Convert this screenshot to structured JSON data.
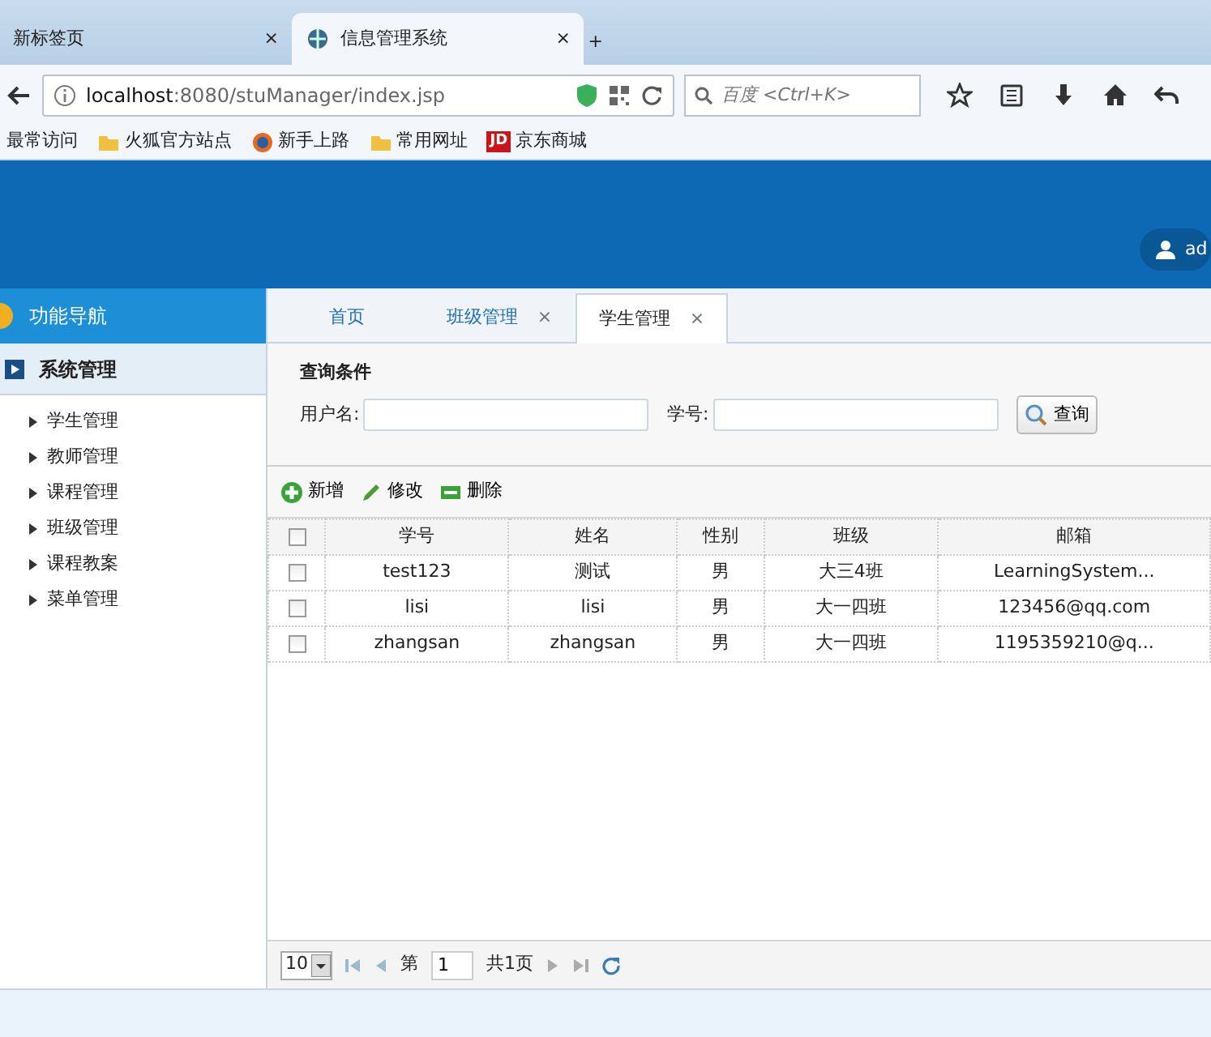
{
  "browser": {
    "tabs": [
      {
        "label": "新标签页",
        "selected": false,
        "close": "×"
      },
      {
        "label": "信息管理系统",
        "selected": true,
        "close": "×"
      }
    ],
    "new_tab": "+",
    "address": "**localhost**:8080/stuManager/index.jsp",
    "search_placeholder": "百度 <Ctrl+K>",
    "bookmarks": [
      {
        "label": "最常访问",
        "kind": "text"
      },
      {
        "label": "火狐官方站点",
        "kind": "folder"
      },
      {
        "label": "新手上路",
        "kind": "firefox"
      },
      {
        "label": "常用网址",
        "kind": "folder"
      },
      {
        "label": "京东商城",
        "kind": "logo",
        "logo_text": "JD"
      }
    ]
  },
  "header": {
    "user": "ad"
  },
  "sidebar": {
    "title": "功能导航",
    "group": {
      "label": "系统管理",
      "items": [
        "学生管理",
        "教师管理",
        "课程管理",
        "班级管理",
        "课程教案",
        "菜单管理"
      ]
    }
  },
  "content_tabs": [
    {
      "label": "首页",
      "selected": false
    },
    {
      "label": "班级管理",
      "selected": false,
      "close": "×"
    },
    {
      "label": "学生管理",
      "selected": true,
      "close": "×"
    }
  ],
  "query": {
    "legend": "查询条件",
    "fields": [
      {
        "label": "用户名:"
      },
      {
        "label": "学号:"
      }
    ],
    "button": "查询"
  },
  "toolbar": [
    {
      "label": "新增",
      "kind": "add"
    },
    {
      "label": "修改",
      "kind": "edit"
    },
    {
      "label": "删除",
      "kind": "delete"
    }
  ],
  "table": {
    "columns": [
      "学号",
      "姓名",
      "性别",
      "班级",
      "邮箱"
    ],
    "header_checked": false,
    "rows": [
      {
        "checked": false,
        "cells": [
          "test123",
          "测试",
          "男",
          "大三4班",
          "LearningSystem..."
        ]
      },
      {
        "checked": false,
        "cells": [
          "lisi",
          "lisi",
          "男",
          "大一四班",
          "123456@qq.com"
        ]
      },
      {
        "checked": false,
        "cells": [
          "zhangsan",
          "zhangsan",
          "男",
          "大一四班",
          "1195359210@q..."
        ]
      }
    ]
  },
  "pager": {
    "page_size": "10",
    "page_prefix": "第",
    "page": "1",
    "total": "共1页"
  }
}
